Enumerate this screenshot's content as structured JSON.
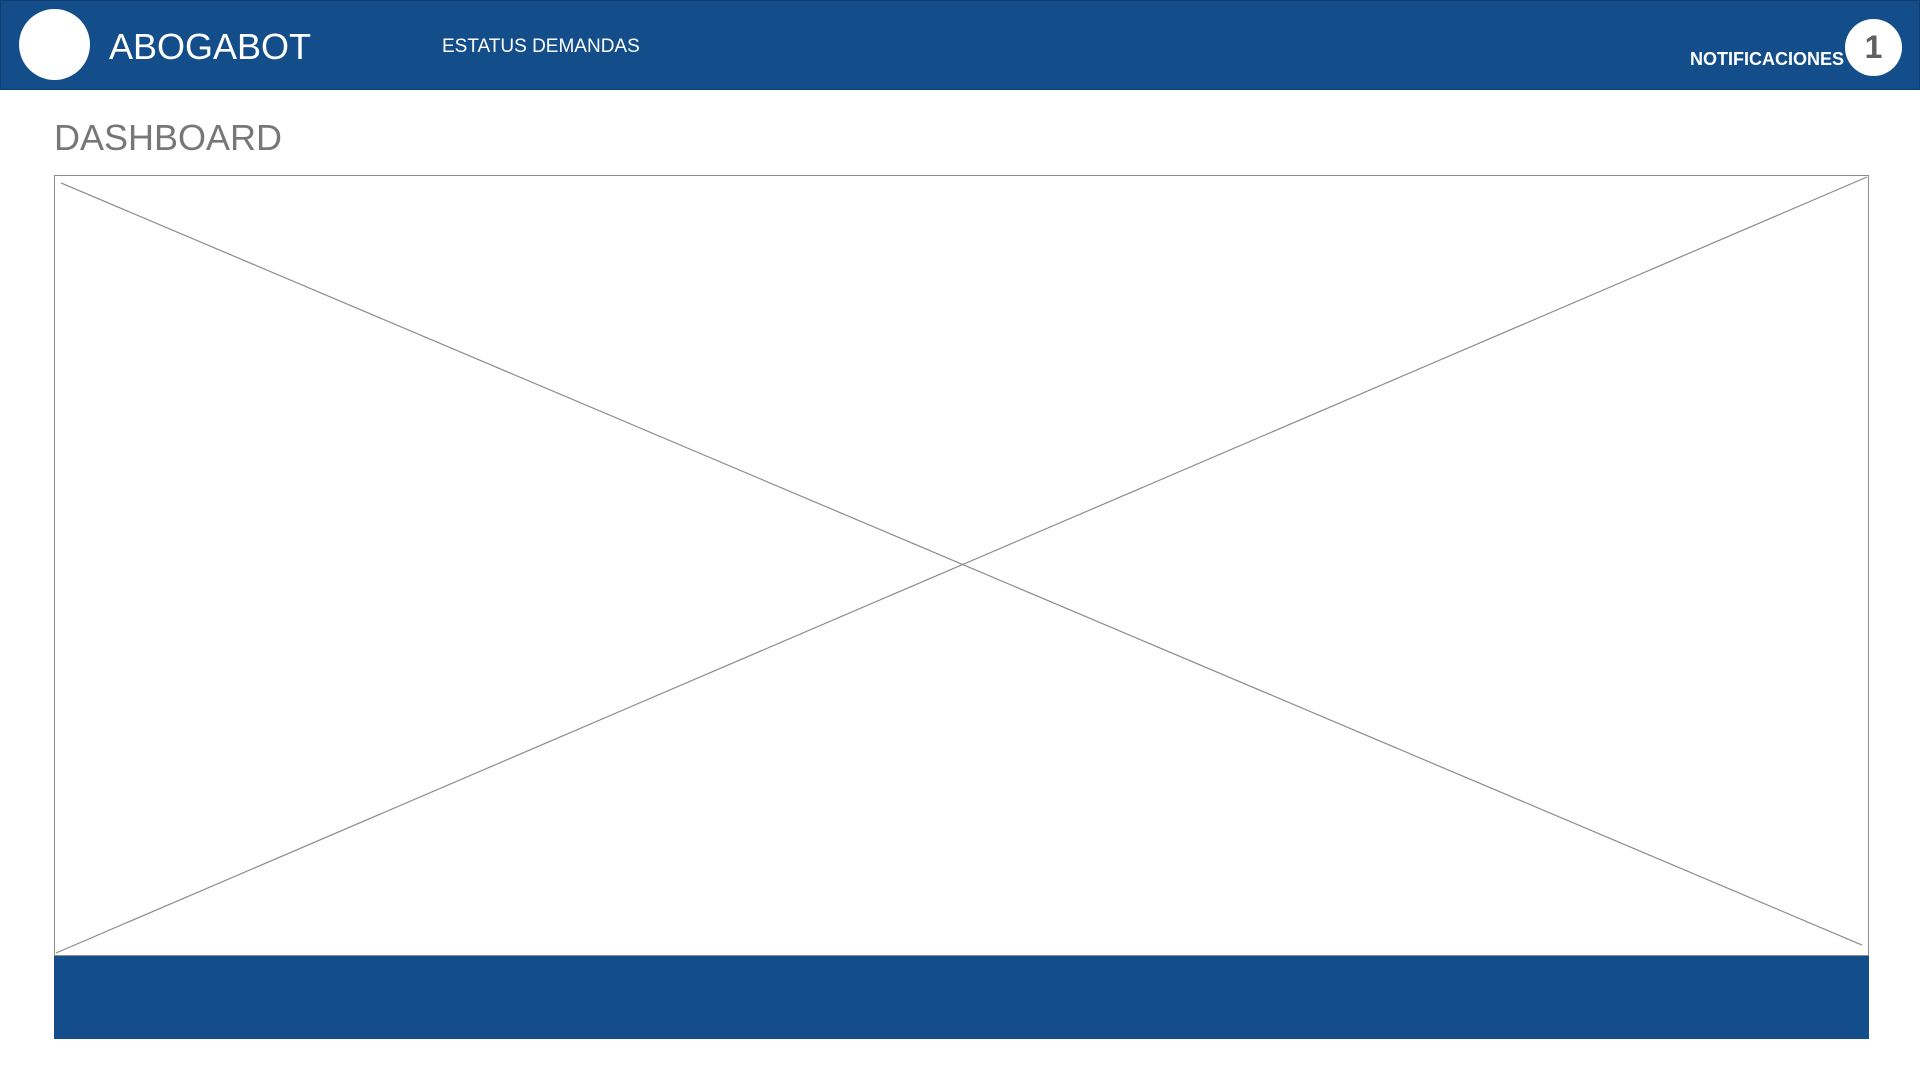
{
  "header": {
    "app_title": "ABOGABOT",
    "nav_label": "ESTATUS DEMANDAS",
    "notifications_label": "NOTIFICACIONES",
    "notifications_count": "1",
    "logo_icon": "logo-placeholder-circle"
  },
  "main": {
    "page_title": "DASHBOARD",
    "placeholder_icon": "image-placeholder-cross"
  },
  "colors": {
    "brand_blue": "#134e8a",
    "title_gray": "#777777",
    "placeholder_line": "#8c8c8c"
  }
}
